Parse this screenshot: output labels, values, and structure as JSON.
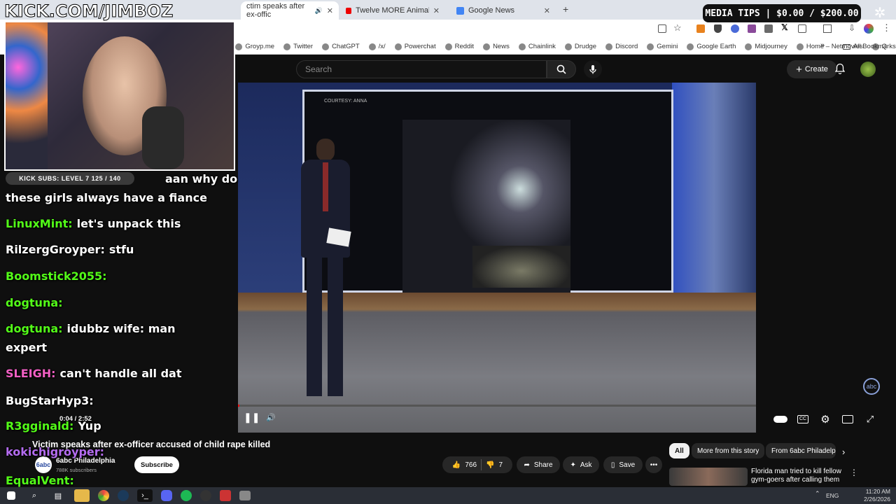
{
  "browser": {
    "tabs": [
      {
        "label": "ctim speaks after ex-offic",
        "active": true
      },
      {
        "label": "Twelve MORE Animal Personali",
        "active": false
      },
      {
        "label": "Google News",
        "active": false
      }
    ],
    "bookmarks": [
      "Groyp.me",
      "Twitter",
      "ChatGPT",
      "/x/",
      "Powerchat",
      "Reddit",
      "News",
      "Chainlink",
      "Drudge",
      "Discord",
      "Gemini",
      "Google Earth",
      "Midjourney",
      "Home – Netmovies",
      "Q"
    ],
    "all_bookmarks": "All Bookmarks"
  },
  "youtube": {
    "search_placeholder": "Search",
    "create_label": "Create",
    "video": {
      "time": "0:04 / 2:52",
      "progress_fraction": 0.0023,
      "courtesy": "COURTESY: ANNA"
    },
    "title": "Victim speaks after ex-officer accused of child rape killed",
    "channel": {
      "name": "6abc Philadelphia",
      "subscribers": "788K subscribers"
    },
    "subscribe_label": "Subscribe",
    "likes": "766",
    "dislikes": "7",
    "share_label": "Share",
    "ask_label": "Ask",
    "save_label": "Save",
    "chips": [
      "All",
      "More from this story",
      "From 6abc Philadelp"
    ],
    "recommended": {
      "title": "Florida man tried to kill fellow gym-goers after calling them ..."
    }
  },
  "overlay": {
    "kick_url": "KICK.COM/JIMBOZ",
    "media_tips": "MEDIA TIPS | $0.00 / $200.00",
    "kick_subs": "KICK SUBS: LEVEL 7 125 / 140",
    "chat": [
      {
        "user": "",
        "text": "aan why do",
        "color": "#ffffff"
      },
      {
        "user": "",
        "text": "these girls always have a fiance",
        "color": "#ffffff"
      },
      {
        "user": "LinuxMint:",
        "text": "let's unpack this",
        "color": "#53fc18"
      },
      {
        "user": "RilzergGroyper:",
        "text": "stfu",
        "color": "#ffffff"
      },
      {
        "user": "Boomstick2055:",
        "text": "",
        "color": "#53fc18"
      },
      {
        "user": "dogtuna:",
        "text": "",
        "color": "#53fc18"
      },
      {
        "user": "dogtuna:",
        "text": "idubbz wife: man",
        "color": "#53fc18"
      },
      {
        "user": "",
        "text": "expert",
        "color": "#ffffff"
      },
      {
        "user": "SLEIGH:",
        "text": "can't handle all dat",
        "color": "#f25fc4"
      },
      {
        "user": "BugStarHyp3:",
        "text": "",
        "color": "#ffffff"
      },
      {
        "user": "R3gginald:",
        "text": "Yup",
        "color": "#53fc18"
      },
      {
        "user": "kokichigroyper:",
        "text": "",
        "color": "#b46cf0"
      },
      {
        "user": "EqualVent:",
        "text": "",
        "color": "#53fc18"
      }
    ]
  },
  "taskbar": {
    "lang": "ENG",
    "time": "11:20 AM",
    "date": "2/26/2026"
  }
}
